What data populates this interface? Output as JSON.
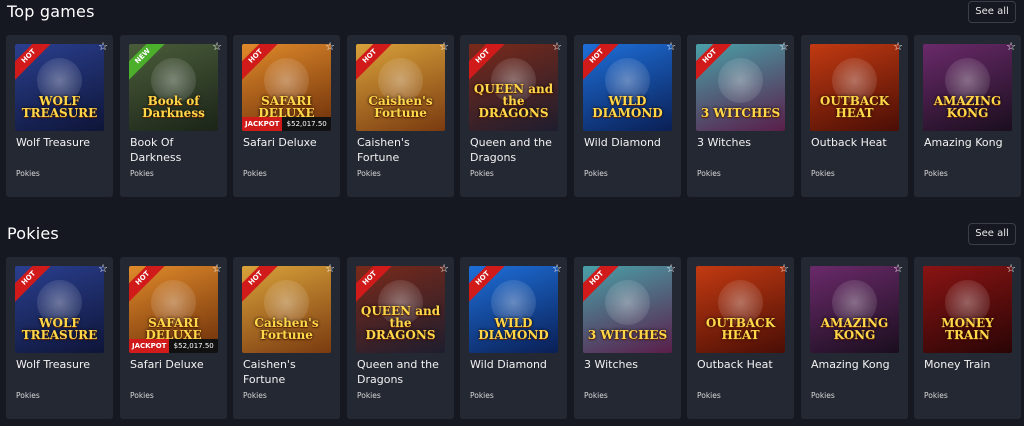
{
  "sections": [
    {
      "title": "Top games",
      "see_all_label": "See all",
      "games": [
        {
          "name": "Wolf Treasure",
          "category": "Pokies",
          "badge": "HOT",
          "thumb_text": "WOLF TREASURE",
          "color_a": "#2a3f8f",
          "color_b": "#0e1538"
        },
        {
          "name": "Book Of Darkness",
          "category": "Pokies",
          "badge": "NEW",
          "thumb_text": "Book of Darkness",
          "color_a": "#4a5d3a",
          "color_b": "#1b2418"
        },
        {
          "name": "Safari Deluxe",
          "category": "Pokies",
          "badge": "HOT",
          "thumb_text": "SAFARI DELUXE",
          "color_a": "#e08a2a",
          "color_b": "#6b2e0a",
          "jackpot_label": "JACKPOT",
          "jackpot_amount": "$52,017.50"
        },
        {
          "name": "Caishen's Fortune",
          "category": "Pokies",
          "badge": "HOT",
          "thumb_text": "Caishen's Fortune",
          "color_a": "#d9a23a",
          "color_b": "#7a3a10"
        },
        {
          "name": "Queen and the Dragons",
          "category": "Pokies",
          "badge": "HOT",
          "thumb_text": "QUEEN and the DRAGONS",
          "color_a": "#7a2a1a",
          "color_b": "#1e1d2e"
        },
        {
          "name": "Wild Diamond",
          "category": "Pokies",
          "badge": "HOT",
          "thumb_text": "WILD DIAMOND",
          "color_a": "#1e6fd9",
          "color_b": "#0a1f55"
        },
        {
          "name": "3 Witches",
          "category": "Pokies",
          "badge": "HOT",
          "thumb_text": "3 WITCHES",
          "color_a": "#4aa0a8",
          "color_b": "#5a1e4a"
        },
        {
          "name": "Outback Heat",
          "category": "Pokies",
          "badge": "",
          "thumb_text": "OUTBACK HEAT",
          "color_a": "#c23a12",
          "color_b": "#4a0e05"
        },
        {
          "name": "Amazing Kong",
          "category": "Pokies",
          "badge": "",
          "thumb_text": "AMAZING KONG",
          "color_a": "#6a2a6a",
          "color_b": "#1a0e1e"
        }
      ]
    },
    {
      "title": "Pokies",
      "see_all_label": "See all",
      "games": [
        {
          "name": "Wolf Treasure",
          "category": "Pokies",
          "badge": "HOT",
          "thumb_text": "WOLF TREASURE",
          "color_a": "#2a3f8f",
          "color_b": "#0e1538"
        },
        {
          "name": "Safari Deluxe",
          "category": "Pokies",
          "badge": "HOT",
          "thumb_text": "SAFARI DELUXE",
          "color_a": "#e08a2a",
          "color_b": "#6b2e0a",
          "jackpot_label": "JACKPOT",
          "jackpot_amount": "$52,017.50"
        },
        {
          "name": "Caishen's Fortune",
          "category": "Pokies",
          "badge": "HOT",
          "thumb_text": "Caishen's Fortune",
          "color_a": "#d9a23a",
          "color_b": "#7a3a10"
        },
        {
          "name": "Queen and the Dragons",
          "category": "Pokies",
          "badge": "HOT",
          "thumb_text": "QUEEN and the DRAGONS",
          "color_a": "#7a2a1a",
          "color_b": "#1e1d2e"
        },
        {
          "name": "Wild Diamond",
          "category": "Pokies",
          "badge": "HOT",
          "thumb_text": "WILD DIAMOND",
          "color_a": "#1e6fd9",
          "color_b": "#0a1f55"
        },
        {
          "name": "3 Witches",
          "category": "Pokies",
          "badge": "HOT",
          "thumb_text": "3 WITCHES",
          "color_a": "#4aa0a8",
          "color_b": "#5a1e4a"
        },
        {
          "name": "Outback Heat",
          "category": "Pokies",
          "badge": "",
          "thumb_text": "OUTBACK HEAT",
          "color_a": "#c23a12",
          "color_b": "#4a0e05"
        },
        {
          "name": "Amazing Kong",
          "category": "Pokies",
          "badge": "",
          "thumb_text": "AMAZING KONG",
          "color_a": "#6a2a6a",
          "color_b": "#1a0e1e"
        },
        {
          "name": "Money Train",
          "category": "Pokies",
          "badge": "",
          "thumb_text": "MONEY TRAIN",
          "color_a": "#8a1414",
          "color_b": "#2a0505"
        }
      ]
    }
  ],
  "icons": {
    "favorite": "star-outline-icon"
  }
}
